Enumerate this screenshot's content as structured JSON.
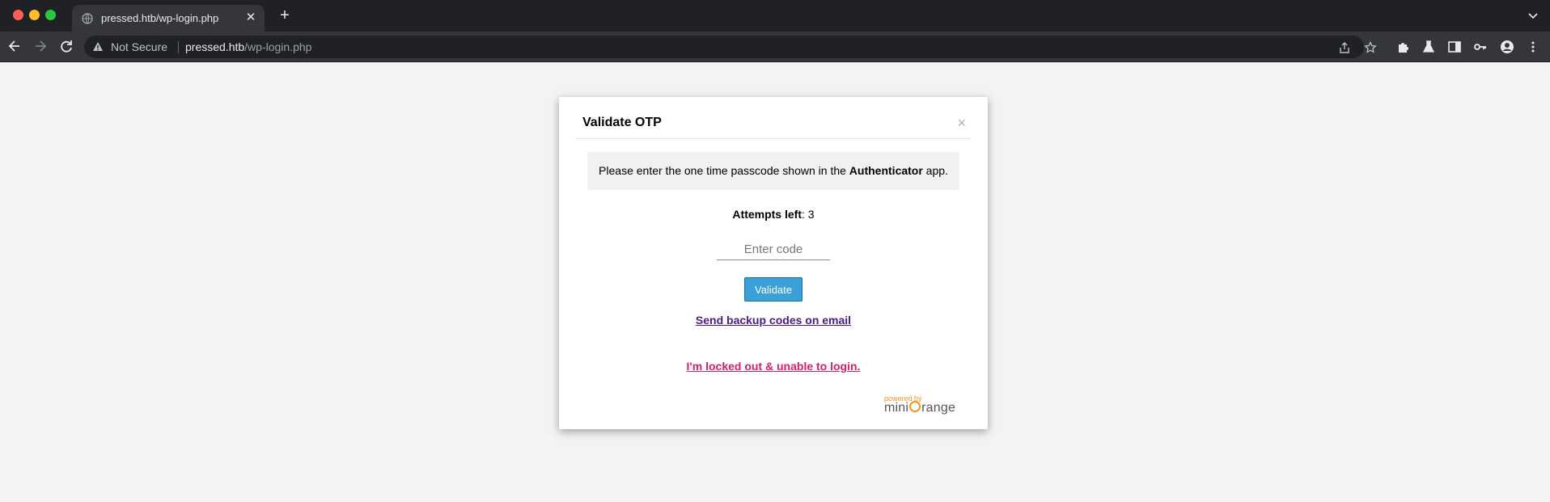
{
  "browser": {
    "tab_title": "pressed.htb/wp-login.php",
    "new_tab_label": "+",
    "tab_close_label": "✕",
    "security_label": "Not Secure",
    "url_host": "pressed.htb",
    "url_path": "/wp-login.php"
  },
  "modal": {
    "title": "Validate OTP",
    "close_label": "×",
    "info_prefix": "Please enter the one time passcode shown in the ",
    "info_bold": "Authenticator",
    "info_suffix": " app.",
    "attempts_label": "Attempts left",
    "attempts_sep": ": ",
    "attempts_value": "3",
    "code_placeholder": "Enter code",
    "code_value": "",
    "validate_label": "Validate",
    "backup_link": "Send backup codes on email",
    "locked_link": "I'm locked out & unable to login.",
    "powered_by": "powered by",
    "brand_part1": "mini",
    "brand_part2": "range"
  },
  "colors": {
    "page_bg": "#f3f3f3",
    "validate_button": "#3aa0d8",
    "backup_link": "#4b1a8a",
    "locked_link": "#d31f66",
    "brand_orange": "#f7941d"
  }
}
